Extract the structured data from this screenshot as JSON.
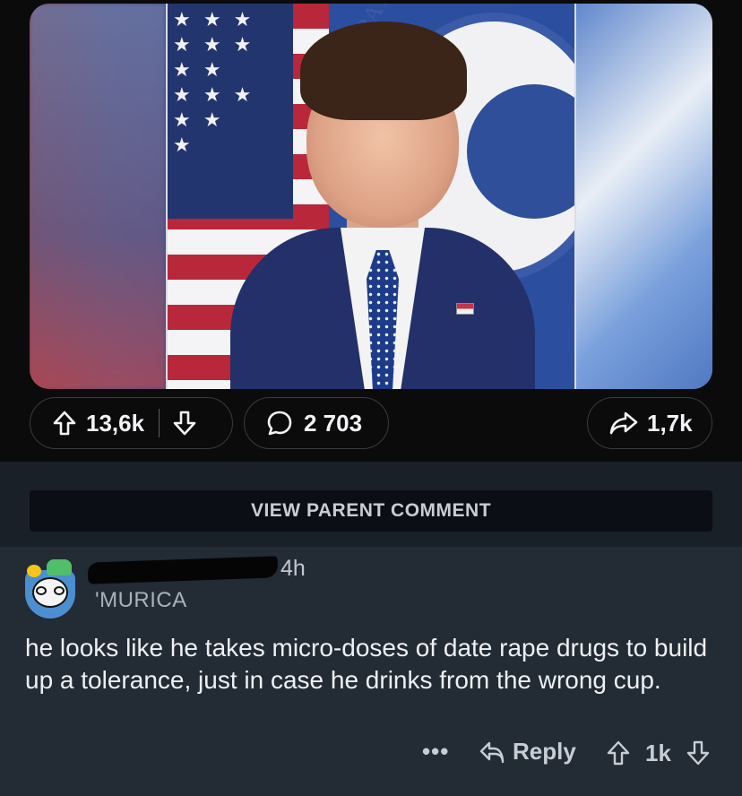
{
  "post": {
    "image": {
      "seal_text": "DEPARTME"
    },
    "actions": {
      "upvotes": "13,6k",
      "comments": "2 703",
      "shares": "1,7k"
    }
  },
  "thread": {
    "view_parent_label": "VIEW PARENT COMMENT",
    "comment": {
      "time": "4h",
      "flair": "'MURICA",
      "text": "he looks like he takes micro-doses of date rape drugs to build up a tolerance, just in case he drinks from the wrong cup.",
      "more": "•••",
      "reply_label": "Reply",
      "votes": "1k"
    }
  },
  "icons": {
    "upvote": "arrow-up-icon",
    "downvote": "arrow-down-icon",
    "comment": "speech-bubble-icon",
    "share": "share-arrow-icon",
    "reply": "reply-arrow-icon",
    "more": "ellipsis-icon"
  },
  "colors": {
    "background": "#0b0b0c",
    "comment_panel": "#1a2028",
    "comment_card": "#232b35",
    "pill_border": "#3a3b3f"
  }
}
